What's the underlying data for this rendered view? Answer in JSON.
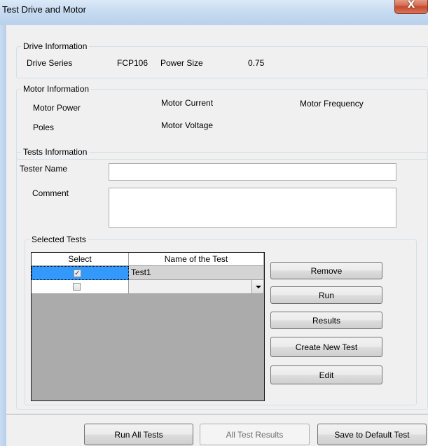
{
  "window": {
    "title": "Test Drive and Motor",
    "close_glyph": "X"
  },
  "drive_info": {
    "legend": "Drive Information",
    "series_label": "Drive Series",
    "series_value": "FCP106",
    "power_label": "Power Size",
    "power_value": "0.75"
  },
  "motor_info": {
    "legend": "Motor Information",
    "power_label": "Motor Power",
    "current_label": "Motor Current",
    "frequency_label": "Motor Frequency",
    "poles_label": "Poles",
    "voltage_label": "Motor Voltage"
  },
  "tests_info": {
    "legend": "Tests Information",
    "tester_label": "Tester Name",
    "tester_value": "",
    "comment_label": "Comment",
    "comment_value": ""
  },
  "selected_tests": {
    "legend": "Selected Tests",
    "columns": [
      "Select",
      "Name of the Test"
    ],
    "rows": [
      {
        "checked": true,
        "check_glyph": "✓",
        "name": "Test1"
      },
      {
        "checked": false,
        "check_glyph": "",
        "name": ""
      }
    ],
    "buttons": {
      "remove": "Remove",
      "run": "Run",
      "results": "Results",
      "create": "Create New Test",
      "edit": "Edit"
    }
  },
  "footer": {
    "run_all": "Run All Tests",
    "all_results": "All Test Results",
    "save_default": "Save to Default Test"
  },
  "colors": {
    "selected_cell": "#3399ff",
    "grid_background": "#ababab",
    "window_background": "#f0f0f0"
  }
}
